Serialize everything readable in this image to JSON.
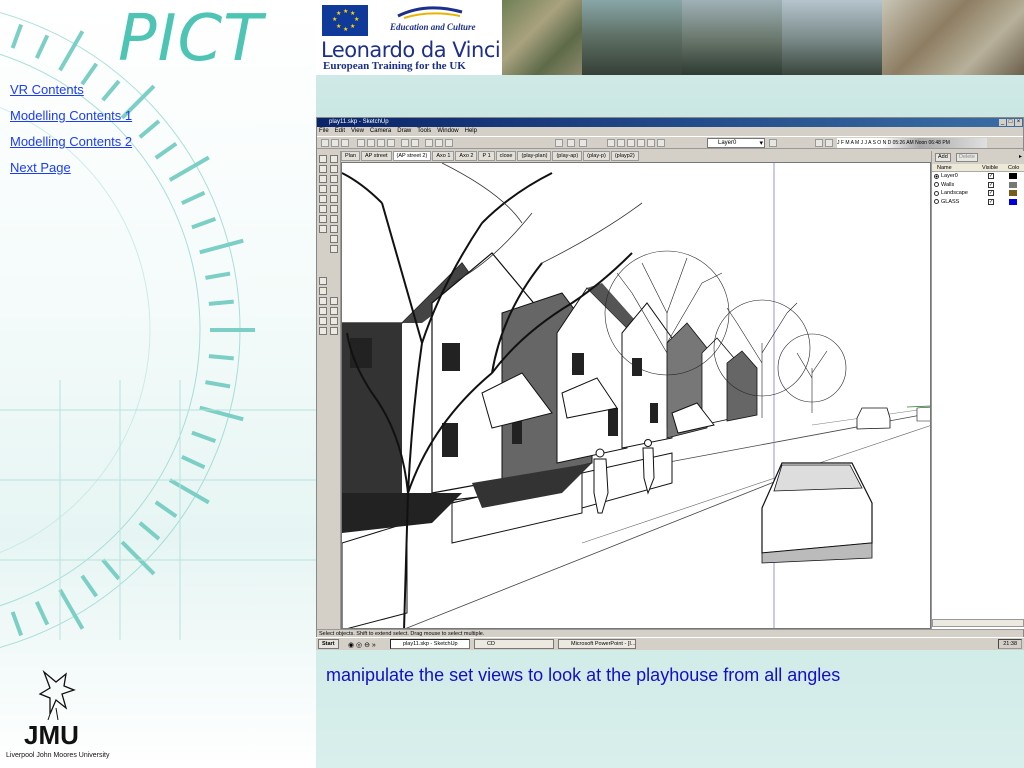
{
  "brand": {
    "pict_logo": "PICT",
    "edu_text": "Education and Culture",
    "leonardo_name": "Leonardo da Vinci",
    "leonardo_sub": "European Training for the UK",
    "jmu_mark": "JMU",
    "jmu_university": "Liverpool John Moores University"
  },
  "nav": {
    "items": [
      {
        "label": "VR Contents"
      },
      {
        "label": "Modelling Contents 1"
      },
      {
        "label": "Modelling Contents 2"
      },
      {
        "label": "Next Page"
      }
    ]
  },
  "sketchup": {
    "title": "play11.skp - SketchUp",
    "menu": [
      "File",
      "Edit",
      "View",
      "Camera",
      "Draw",
      "Tools",
      "Window",
      "Help"
    ],
    "layer_selected": "Layer0",
    "shadow_months": "J F M A M J J A S O N D",
    "shadow_time_start": "05:26 AM",
    "shadow_time_noon": "Noon",
    "shadow_time_end": "06:48 PM",
    "view_tabs": [
      "Plan",
      "AP street",
      "(AP street 2)",
      "Axo 1",
      "Axo 2",
      "P 1",
      "close",
      "(play-plan)",
      "(play-ap)",
      "(play-p)",
      "(playp2)"
    ],
    "active_tab_index": 2,
    "layers_panel": {
      "add_label": "Add",
      "delete_label": "Delete",
      "col_name": "Name",
      "col_visible": "Visible",
      "col_color": "Colo",
      "rows": [
        {
          "name": "Layer0",
          "visible": true,
          "color": "#000000",
          "current": true
        },
        {
          "name": "Walls",
          "visible": true,
          "color": "#777777",
          "current": false
        },
        {
          "name": "Landscape",
          "visible": true,
          "color": "#7a5a1a",
          "current": false
        },
        {
          "name": "GLASS",
          "visible": true,
          "color": "#0000dd",
          "current": false
        }
      ]
    },
    "status_text": "Select objects. Shift to extend select. Drag mouse to select multiple."
  },
  "taskbar": {
    "start_label": "Start",
    "tasks": [
      "play11.skp - SketchUp",
      "CD",
      "Microsoft PowerPoint - [I..."
    ],
    "clock": "21:38"
  },
  "caption": "manipulate the set views to look at the playhouse from all angles",
  "colors": {
    "link": "#1a3cff",
    "caption": "#1010cc",
    "pict": "#4ec4b4",
    "leonardo": "#1c2f8c"
  }
}
